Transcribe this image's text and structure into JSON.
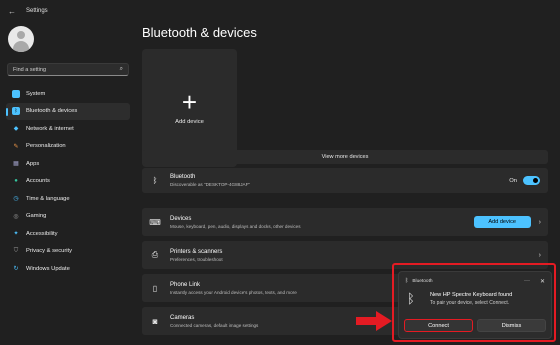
{
  "window": {
    "title": "Settings"
  },
  "search": {
    "placeholder": "Find a setting"
  },
  "nav": [
    {
      "label": "System",
      "icon": "system-icon",
      "color": "#4cc2ff"
    },
    {
      "label": "Bluetooth & devices",
      "icon": "bluetooth-icon",
      "color": "#4cc2ff",
      "active": true
    },
    {
      "label": "Network & internet",
      "icon": "network-icon",
      "color": "#4cc2ff"
    },
    {
      "label": "Personalization",
      "icon": "brush-icon",
      "color": "#f2994a"
    },
    {
      "label": "Apps",
      "icon": "apps-icon",
      "color": "#a0a0c8"
    },
    {
      "label": "Accounts",
      "icon": "accounts-icon",
      "color": "#35c7a0"
    },
    {
      "label": "Time & language",
      "icon": "time-icon",
      "color": "#4cc2ff"
    },
    {
      "label": "Gaming",
      "icon": "gaming-icon",
      "color": "#a0a0a0"
    },
    {
      "label": "Accessibility",
      "icon": "accessibility-icon",
      "color": "#4cc2ff"
    },
    {
      "label": "Privacy & security",
      "icon": "shield-icon",
      "color": "#a0a0a0"
    },
    {
      "label": "Windows Update",
      "icon": "update-icon",
      "color": "#4cc2ff"
    }
  ],
  "main": {
    "title": "Bluetooth & devices",
    "add_tile_label": "Add device",
    "view_more": "View more devices",
    "bluetooth": {
      "title": "Bluetooth",
      "subtitle": "Discoverable as \"DESKTOP-4G88JAF\"",
      "state": "On"
    },
    "devices": {
      "title": "Devices",
      "subtitle": "Mouse, keyboard, pen, audio, displays and docks, other devices",
      "button": "Add device"
    },
    "printers": {
      "title": "Printers & scanners",
      "subtitle": "Preferences, troubleshoot"
    },
    "phone": {
      "title": "Phone Link",
      "subtitle": "Instantly access your Android device's photos, texts, and more"
    },
    "cameras": {
      "title": "Cameras",
      "subtitle": "Connected cameras, default image settings"
    }
  },
  "notification": {
    "app": "Bluetooth",
    "title": "New HP Spectre Keyboard found",
    "body": "To pair your device, select Connect.",
    "connect": "Connect",
    "dismiss": "Dismiss"
  },
  "accent": "#4cc2ff",
  "highlight": "#e41b23"
}
